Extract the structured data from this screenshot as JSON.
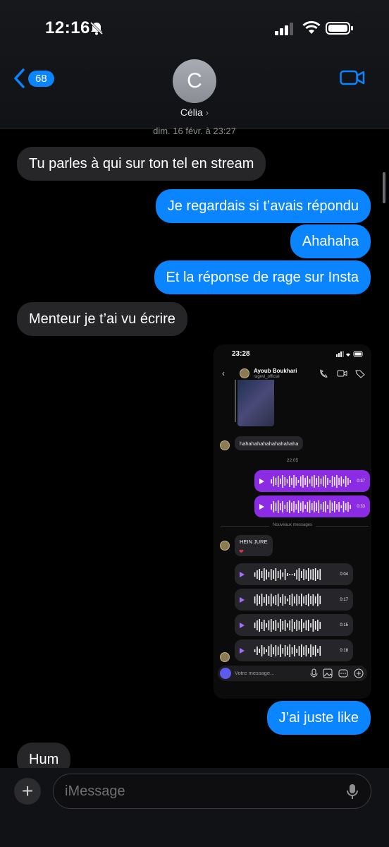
{
  "status_bar": {
    "time": "12:16"
  },
  "header": {
    "back_count": "68",
    "avatar_initial": "C",
    "contact_name": "Célia",
    "contact_chevron": "›"
  },
  "conversation": {
    "date": "dim. 16 févr. à 23:27",
    "messages": [
      {
        "sender": "them",
        "text": "Tu parles à qui sur ton tel en stream"
      },
      {
        "sender": "me",
        "text": "Je regardais si t’avais répondu"
      },
      {
        "sender": "me",
        "text": "Ahahaha"
      },
      {
        "sender": "me",
        "text": "Et la réponse de rage sur Insta"
      },
      {
        "sender": "them",
        "text": "Menteur je t’ai vu écrire"
      },
      {
        "sender": "me",
        "text": "J’ai juste like"
      },
      {
        "sender": "them",
        "text": "Hum"
      }
    ]
  },
  "attachment": {
    "time": "23:28",
    "name": "Ayoub Boukhari",
    "username": "ragevl_official",
    "message_text": "hahahahahahahahahaha",
    "timestamp": "22:05",
    "voice_mine": [
      "0:37",
      "0:33"
    ],
    "new_messages_label": "Nouveaux messages",
    "reply_text": "HEIN JURE",
    "reaction": "❤",
    "voice_theirs": [
      "0:04",
      "0:17",
      "0:15",
      "0:18"
    ],
    "input_placeholder": "Votre message..."
  },
  "input": {
    "plus": "+",
    "placeholder": "iMessage"
  },
  "colors": {
    "blue": "#0a84ff",
    "gray_bubble": "#262628",
    "purple": "#8b2be3"
  }
}
